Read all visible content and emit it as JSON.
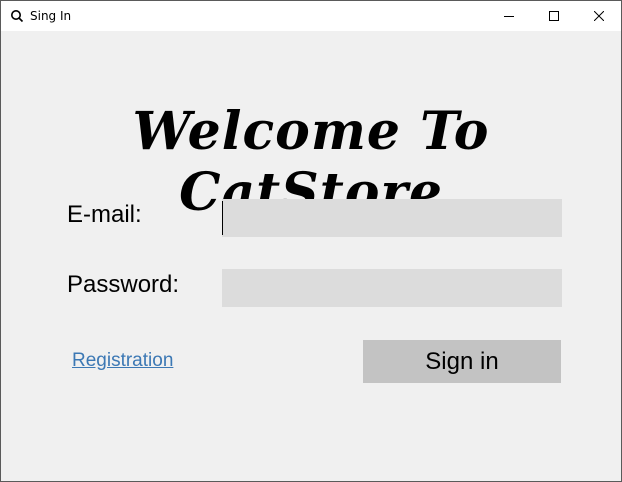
{
  "window": {
    "title": "Sing In",
    "icon": "magnifier-icon",
    "controls": {
      "minimize": "minimize-icon",
      "maximize": "maximize-icon",
      "close": "close-icon"
    }
  },
  "form": {
    "heading": "Welcome To CatStore",
    "email_label": "E-mail:",
    "email_value": "",
    "password_label": "Password:",
    "password_value": "",
    "registration_link": "Registration",
    "signin_button": "Sign in"
  },
  "colors": {
    "background": "#f0f0f0",
    "field_background": "#dcdcdc",
    "button_background": "#c3c3c3",
    "link": "#3c78b4"
  }
}
